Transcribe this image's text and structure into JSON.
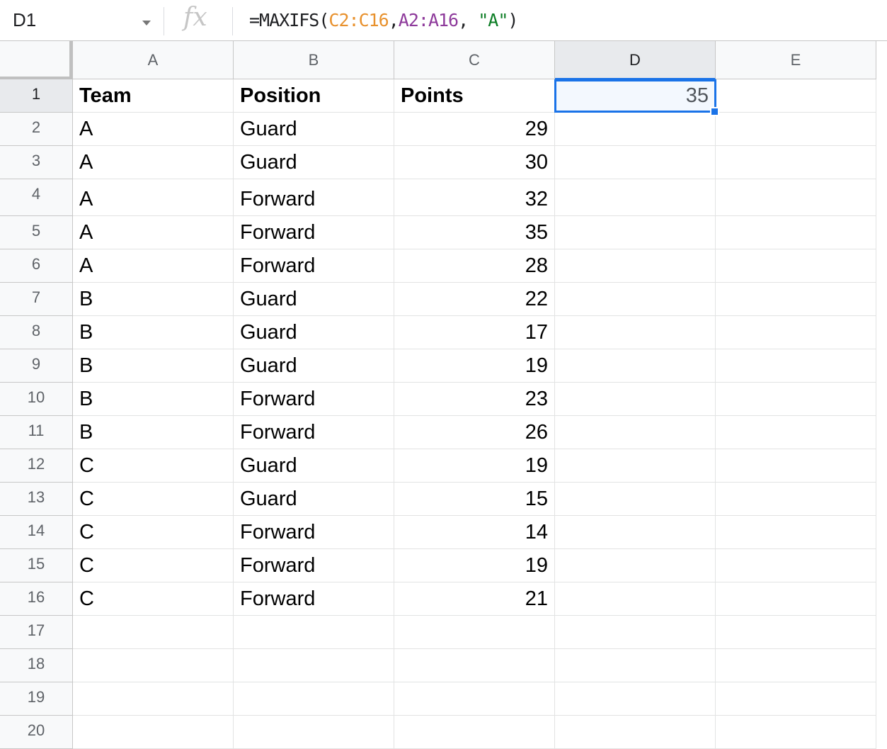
{
  "name_box": "D1",
  "fx_label": "fx",
  "formula": {
    "prefix": "=MAXIFS(",
    "ref1": "C2:C16",
    "comma1": ",",
    "ref2": "A2:A16",
    "comma2": ", ",
    "criterion": "\"A\"",
    "suffix": ")"
  },
  "columns": [
    "A",
    "B",
    "C",
    "D",
    "E"
  ],
  "selected_column": "D",
  "selected_cell": "D1",
  "header_row": {
    "team": "Team",
    "position": "Position",
    "points": "Points",
    "d1_value": "35"
  },
  "rows": [
    {
      "row": "2",
      "team": "A",
      "position": "Guard",
      "points": "29"
    },
    {
      "row": "3",
      "team": "A",
      "position": "Guard",
      "points": "30"
    },
    {
      "row": "4",
      "team": "A",
      "position": "Forward",
      "points": "32"
    },
    {
      "row": "5",
      "team": "A",
      "position": "Forward",
      "points": "35"
    },
    {
      "row": "6",
      "team": "A",
      "position": "Forward",
      "points": "28"
    },
    {
      "row": "7",
      "team": "B",
      "position": "Guard",
      "points": "22"
    },
    {
      "row": "8",
      "team": "B",
      "position": "Guard",
      "points": "17"
    },
    {
      "row": "9",
      "team": "B",
      "position": "Guard",
      "points": "19"
    },
    {
      "row": "10",
      "team": "B",
      "position": "Forward",
      "points": "23"
    },
    {
      "row": "11",
      "team": "B",
      "position": "Forward",
      "points": "26"
    },
    {
      "row": "12",
      "team": "C",
      "position": "Guard",
      "points": "19"
    },
    {
      "row": "13",
      "team": "C",
      "position": "Guard",
      "points": "15"
    },
    {
      "row": "14",
      "team": "C",
      "position": "Forward",
      "points": "14"
    },
    {
      "row": "15",
      "team": "C",
      "position": "Forward",
      "points": "19"
    },
    {
      "row": "16",
      "team": "C",
      "position": "Forward",
      "points": "21"
    }
  ],
  "row_numbers": [
    "1",
    "2",
    "3",
    "4",
    "5",
    "6",
    "7",
    "8",
    "9",
    "10",
    "11",
    "12",
    "13",
    "14",
    "15",
    "16",
    "17",
    "18",
    "19",
    "20"
  ]
}
